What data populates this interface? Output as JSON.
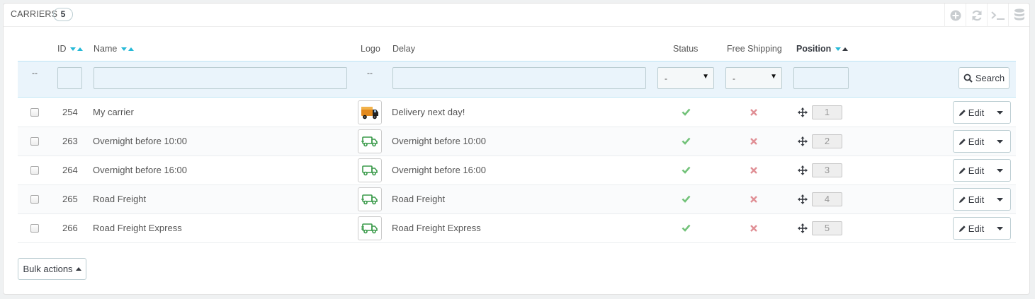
{
  "panel": {
    "title": "CARRIERS",
    "count": "5"
  },
  "toolbar": {
    "icons": [
      "add-icon",
      "refresh-icon",
      "sql-query-icon",
      "export-database-icon"
    ]
  },
  "columns": {
    "id": "ID",
    "name": "Name",
    "logo": "Logo",
    "delay": "Delay",
    "status": "Status",
    "free_shipping": "Free Shipping",
    "position": "Position"
  },
  "filters": {
    "checkbox_placeholder": "--",
    "logo_placeholder": "--",
    "status_value": "-",
    "free_shipping_value": "-",
    "search_label": "Search"
  },
  "rows": [
    {
      "id": "254",
      "name": "My carrier",
      "delay": "Delivery next day!",
      "position": "1",
      "logo": "orange-truck-logo",
      "status": "enabled",
      "free_shipping": "no"
    },
    {
      "id": "263",
      "name": "Overnight before 10:00",
      "delay": "Overnight before 10:00",
      "position": "2",
      "logo": "green-truck-logo",
      "status": "enabled",
      "free_shipping": "no"
    },
    {
      "id": "264",
      "name": "Overnight before 16:00",
      "delay": "Overnight before 16:00",
      "position": "3",
      "logo": "green-truck-logo",
      "status": "enabled",
      "free_shipping": "no"
    },
    {
      "id": "265",
      "name": "Road Freight",
      "delay": "Road Freight",
      "position": "4",
      "logo": "green-truck-logo",
      "status": "enabled",
      "free_shipping": "no"
    },
    {
      "id": "266",
      "name": "Road Freight Express",
      "delay": "Road Freight Express",
      "position": "5",
      "logo": "green-truck-logo",
      "status": "enabled",
      "free_shipping": "no"
    }
  ],
  "row_actions": {
    "edit_label": "Edit"
  },
  "footer": {
    "bulk_actions_label": "Bulk actions"
  },
  "colors": {
    "accent": "#25b9d7",
    "success": "#72c279",
    "danger": "#e08f95",
    "truck_green": "#3a9a4a"
  }
}
